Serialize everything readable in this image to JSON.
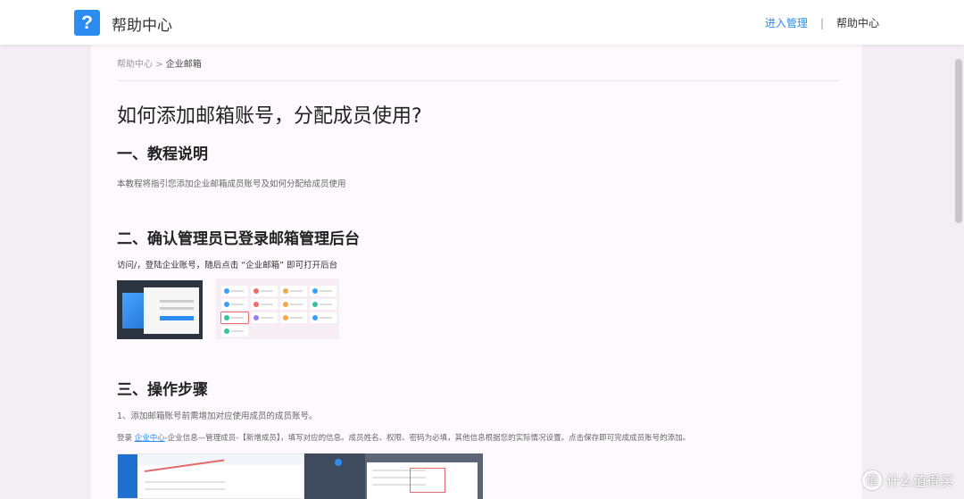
{
  "header": {
    "logo_char": "?",
    "brand": "帮助中心",
    "nav_admin": "进入管理",
    "nav_sep": "|",
    "nav_help": "帮助中心"
  },
  "breadcrumb": {
    "root": "帮助中心",
    "sep": ">",
    "current": "企业邮箱"
  },
  "article": {
    "title": "如何添加邮箱账号，分配成员使用?",
    "section1": {
      "heading": "一、教程说明",
      "text": "本教程将指引您添加企业邮箱成员账号及如何分配给成员使用"
    },
    "section2": {
      "heading": "二、确认管理员已登录邮箱管理后台",
      "text": "访问/，登陆企业账号，随后点击 “企业邮箱” 即可打开后台"
    },
    "section3": {
      "heading": "三、操作步骤",
      "step1": "1、添加邮箱账号前需增加对应使用成员的成员账号。",
      "step1_detail_prefix": "登录 ",
      "step1_link": "企业中心",
      "step1_detail_suffix": "-企业信息—管理成员-【新增成员】，填写对应的信息。成员姓名、权限、密码为必填，其他信息根据您的实际情况设置。点击保存即可完成成员账号的添加。"
    }
  },
  "watermark": {
    "icon": "值",
    "text": "什么值得买"
  },
  "colors": {
    "accent": "#2d8cf0",
    "highlight": "#e46b6b"
  }
}
